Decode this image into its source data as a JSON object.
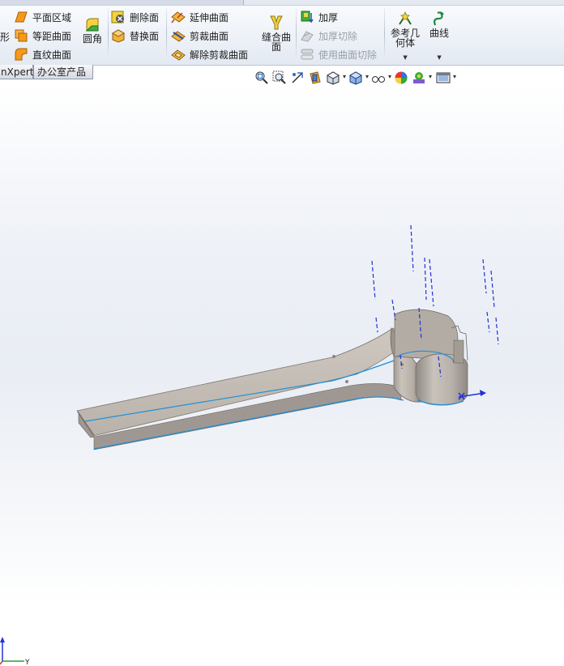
{
  "ribbon": {
    "col1": [
      {
        "label": "平面区域",
        "icon": "planar-surface-icon"
      },
      {
        "label": "等距曲面",
        "icon": "offset-surface-icon"
      },
      {
        "label": "直纹曲面",
        "icon": "ruled-surface-icon"
      }
    ],
    "cut_label": "形",
    "fillet": {
      "label": "圆角",
      "icon": "fillet-icon"
    },
    "col2": [
      {
        "label": "删除面",
        "icon": "delete-face-icon"
      },
      {
        "label": "替换面",
        "icon": "replace-face-icon"
      }
    ],
    "col3": [
      {
        "label": "延伸曲面",
        "icon": "extend-surface-icon"
      },
      {
        "label": "剪裁曲面",
        "icon": "trim-surface-icon"
      },
      {
        "label": "解除剪裁曲面",
        "icon": "untrim-surface-icon"
      }
    ],
    "knit": {
      "line1": "缝合曲",
      "line2": "面",
      "icon": "knit-surface-icon"
    },
    "col4": [
      {
        "label": "加厚",
        "icon": "thicken-icon",
        "enabled": true
      },
      {
        "label": "加厚切除",
        "icon": "thicken-cut-icon",
        "enabled": false
      },
      {
        "label": "使用曲面切除",
        "icon": "surface-cut-icon",
        "enabled": false
      }
    ],
    "ref_geom": {
      "line1": "参考几",
      "line2": "何体",
      "icon": "reference-geometry-icon"
    },
    "curves": {
      "label": "曲线",
      "icon": "curves-icon"
    }
  },
  "tabs": [
    {
      "label": "nXpert"
    },
    {
      "label": "办公室产品"
    }
  ],
  "view_toolbar": [
    "zoom-to-fit-icon",
    "zoom-to-area-icon",
    "previous-view-icon",
    "section-view-icon",
    "view-orientation-icon",
    "display-style-icon",
    "hide-show-items-icon",
    "edit-appearance-icon",
    "apply-scene-icon",
    "view-settings-icon"
  ],
  "triad": {
    "axis_y_label": "Y"
  },
  "colors": {
    "part_face": "#bdb6ae",
    "part_side": "#a69f98",
    "edge_highlight": "#1f8fd6",
    "sketch_blue": "#2231d8"
  }
}
